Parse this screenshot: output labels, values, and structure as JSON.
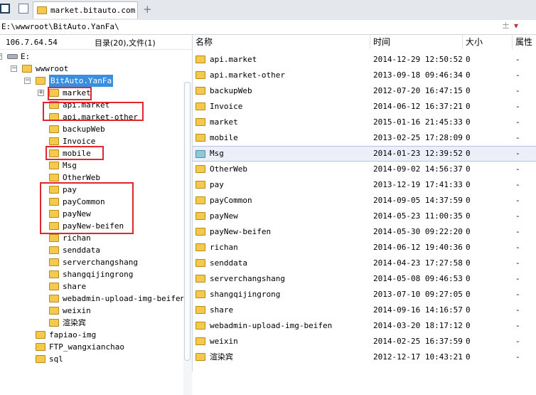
{
  "tabbar": {
    "tab_title": "market.bitauto.com",
    "new_tab_icon": "plus-icon"
  },
  "address": {
    "path": "E:\\wwwroot\\BitAuto.YanFa\\"
  },
  "left": {
    "ip": "106.7.64.54",
    "summary": "目录(20),文件(1)",
    "tree": [
      {
        "label": "E:",
        "level": 0,
        "expander": "-",
        "icon": "drive-icon"
      },
      {
        "label": "wwwroot",
        "level": 1,
        "expander": "-"
      },
      {
        "label": "BitAuto.YanFa",
        "level": 2,
        "expander": "-",
        "selected": true
      },
      {
        "label": "market",
        "level": 3,
        "expander": "+"
      },
      {
        "label": "api.market",
        "level": 3
      },
      {
        "label": "api.market-other",
        "level": 3
      },
      {
        "label": "backupWeb",
        "level": 3
      },
      {
        "label": "Invoice",
        "level": 3
      },
      {
        "label": "mobile",
        "level": 3
      },
      {
        "label": "Msg",
        "level": 3
      },
      {
        "label": "OtherWeb",
        "level": 3
      },
      {
        "label": "pay",
        "level": 3
      },
      {
        "label": "payCommon",
        "level": 3
      },
      {
        "label": "payNew",
        "level": 3
      },
      {
        "label": "payNew-beifen",
        "level": 3
      },
      {
        "label": "richan",
        "level": 3
      },
      {
        "label": "senddata",
        "level": 3
      },
      {
        "label": "serverchangshang",
        "level": 3
      },
      {
        "label": "shangqijingrong",
        "level": 3
      },
      {
        "label": "share",
        "level": 3
      },
      {
        "label": "webadmin-upload-img-beifen",
        "level": 3
      },
      {
        "label": "weixin",
        "level": 3
      },
      {
        "label": "渲染宾",
        "level": 3
      },
      {
        "label": "fapiao-img",
        "level": 2
      },
      {
        "label": "FTP_wangxianchao",
        "level": 2
      },
      {
        "label": "sql",
        "level": 2
      }
    ]
  },
  "right": {
    "headers": {
      "name": "名称",
      "time": "时间",
      "size": "大小",
      "attr": "属性"
    },
    "rows": [
      {
        "name": "api.market",
        "time": "2014-12-29 12:50:52",
        "size": "0",
        "attr": "-"
      },
      {
        "name": "api.market-other",
        "time": "2013-09-18 09:46:34",
        "size": "0",
        "attr": "-"
      },
      {
        "name": "backupWeb",
        "time": "2012-07-20 16:47:15",
        "size": "0",
        "attr": "-"
      },
      {
        "name": "Invoice",
        "time": "2014-06-12 16:37:21",
        "size": "0",
        "attr": "-"
      },
      {
        "name": "market",
        "time": "2015-01-16 21:45:33",
        "size": "0",
        "attr": "-"
      },
      {
        "name": "mobile",
        "time": "2013-02-25 17:28:09",
        "size": "0",
        "attr": "-"
      },
      {
        "name": "Msg",
        "time": "2014-01-23 12:39:52",
        "size": "0",
        "attr": "-",
        "selected": true
      },
      {
        "name": "OtherWeb",
        "time": "2014-09-02 14:56:37",
        "size": "0",
        "attr": "-"
      },
      {
        "name": "pay",
        "time": "2013-12-19 17:41:33",
        "size": "0",
        "attr": "-"
      },
      {
        "name": "payCommon",
        "time": "2014-09-05 14:37:59",
        "size": "0",
        "attr": "-"
      },
      {
        "name": "payNew",
        "time": "2014-05-23 11:00:35",
        "size": "0",
        "attr": "-"
      },
      {
        "name": "payNew-beifen",
        "time": "2014-05-30 09:22:20",
        "size": "0",
        "attr": "-"
      },
      {
        "name": "richan",
        "time": "2014-06-12 19:40:36",
        "size": "0",
        "attr": "-"
      },
      {
        "name": "senddata",
        "time": "2014-04-23 17:27:58",
        "size": "0",
        "attr": "-"
      },
      {
        "name": "serverchangshang",
        "time": "2014-05-08 09:46:53",
        "size": "0",
        "attr": "-"
      },
      {
        "name": "shangqijingrong",
        "time": "2013-07-10 09:27:05",
        "size": "0",
        "attr": "-"
      },
      {
        "name": "share",
        "time": "2014-09-16 14:16:57",
        "size": "0",
        "attr": "-"
      },
      {
        "name": "webadmin-upload-img-beifen",
        "time": "2014-03-20 18:17:12",
        "size": "0",
        "attr": "-"
      },
      {
        "name": "weixin",
        "time": "2014-02-25 16:37:59",
        "size": "0",
        "attr": "-"
      },
      {
        "name": "渲染宾",
        "time": "2012-12-17 10:43:21",
        "size": "0",
        "attr": "-"
      }
    ]
  },
  "colors": {
    "highlight_box": "#e0262f",
    "selection": "#3a8ee0",
    "folder": "#f5c94b"
  }
}
